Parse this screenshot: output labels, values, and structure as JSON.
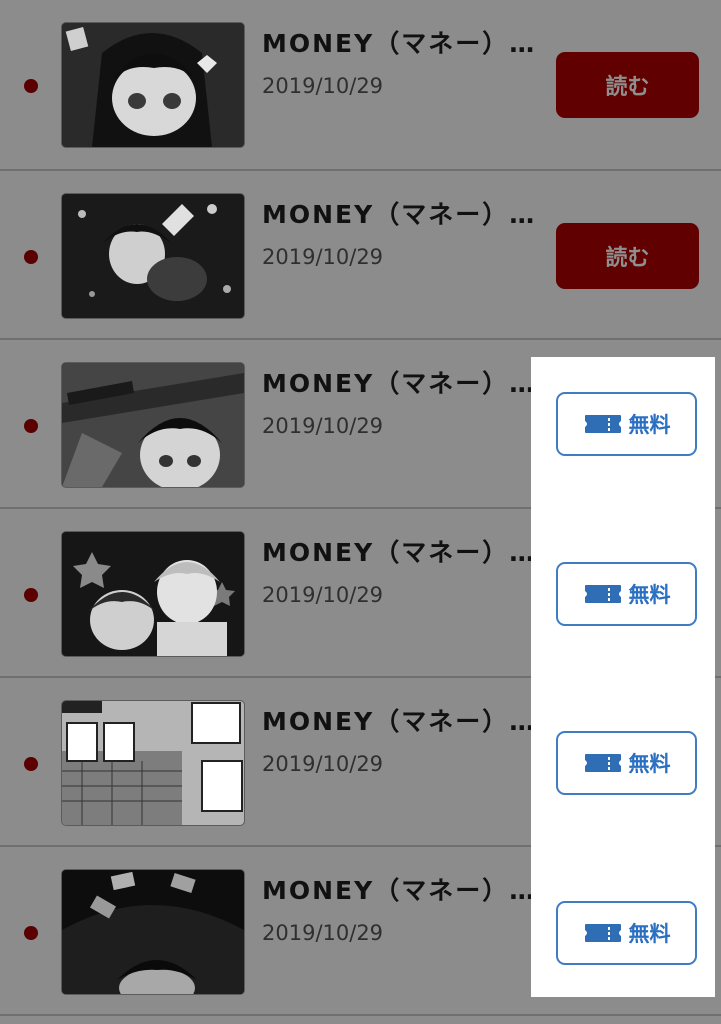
{
  "colors": {
    "overlay": "#8c8c8c",
    "read_button": "#610000",
    "free_button_border": "#3f7cc2",
    "unread_dot": "#5a0000"
  },
  "items": [
    {
      "title": "MONEY（マネー）…",
      "date": "2019/10/29",
      "action": "読む",
      "action_type": "read",
      "unread": true
    },
    {
      "title": "MONEY（マネー）…",
      "date": "2019/10/29",
      "action": "読む",
      "action_type": "read",
      "unread": true
    },
    {
      "title": "MONEY（マネー）…",
      "date": "2019/10/29",
      "action": "無料",
      "action_type": "free",
      "icon": "ticket-icon",
      "unread": true
    },
    {
      "title": "MONEY（マネー）…",
      "date": "2019/10/29",
      "action": "無料",
      "action_type": "free",
      "icon": "ticket-icon",
      "unread": true
    },
    {
      "title": "MONEY（マネー）…",
      "date": "2019/10/29",
      "action": "無料",
      "action_type": "free",
      "icon": "ticket-icon",
      "unread": true
    },
    {
      "title": "MONEY（マネー）…",
      "date": "2019/10/29",
      "action": "無料",
      "action_type": "free",
      "icon": "ticket-icon",
      "unread": true
    }
  ]
}
